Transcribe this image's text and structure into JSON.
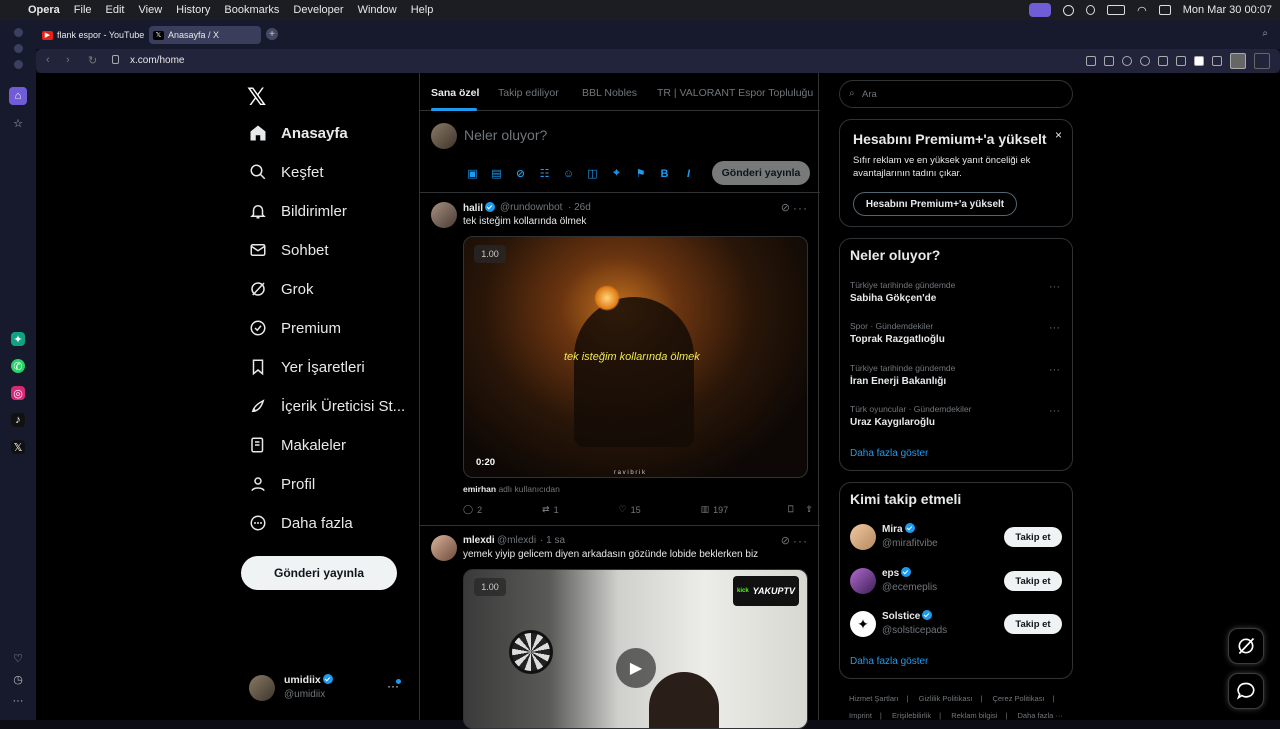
{
  "mac_menu": {
    "apple": "",
    "app": "Opera",
    "items": [
      "File",
      "Edit",
      "View",
      "History",
      "Bookmarks",
      "Developer",
      "Window",
      "Help"
    ],
    "clock": "Mon Mar 30  00:07"
  },
  "browser": {
    "tabs": [
      {
        "title": "flank espor - YouTube",
        "favicon": "youtube-icon"
      },
      {
        "title": "Anasayfa / X",
        "favicon": "x-icon"
      }
    ],
    "url": "x.com/home"
  },
  "left_nav": {
    "items": [
      {
        "label": "Anasayfa",
        "icon": "home-icon"
      },
      {
        "label": "Keşfet",
        "icon": "search-icon"
      },
      {
        "label": "Bildirimler",
        "icon": "bell-icon"
      },
      {
        "label": "Sohbet",
        "icon": "mail-icon"
      },
      {
        "label": "Grok",
        "icon": "grok-icon"
      },
      {
        "label": "Premium",
        "icon": "premium-icon"
      },
      {
        "label": "Yer İşaretleri",
        "icon": "bookmark-icon"
      },
      {
        "label": "İçerik Üreticisi St...",
        "icon": "rocket-icon"
      },
      {
        "label": "Makaleler",
        "icon": "article-icon"
      },
      {
        "label": "Profil",
        "icon": "person-icon"
      },
      {
        "label": "Daha fazla",
        "icon": "more-circle-icon"
      }
    ],
    "post_button": "Gönderi yayınla",
    "account": {
      "name": "umidiix",
      "handle": "@umidiix"
    }
  },
  "feed": {
    "tabs": [
      "Sana özel",
      "Takip ediliyor",
      "BBL Nobles",
      "TR | VALORANT Espor Topluluğu"
    ],
    "composer": {
      "placeholder": "Neler oluyor?",
      "post_button": "Gönderi yayınla"
    },
    "tweets": [
      {
        "name": "halil",
        "handle": "@rundownbot",
        "time": "· 26d",
        "text": "tek isteğim kollarında ölmek",
        "media_caption": "tek isteğim kollarında ölmek",
        "media_speed": "1.00",
        "media_duration": "0:20",
        "watermark": "r a v i b r i k",
        "tagged_user": "emirhan",
        "tagged_suffix": "adlı kullanıcıdan",
        "replies": "2",
        "reposts": "1",
        "likes": "15",
        "views": "197"
      },
      {
        "name": "mlexdi",
        "handle": "@mlexdi",
        "time": "· 1 sa",
        "text": "yemek yiyip gelicem diyen arkadasın gözünde lobide beklerken biz",
        "media_speed": "1.00",
        "overlay_logo": "YAKUPTV",
        "overlay_kick": "kick"
      }
    ]
  },
  "right_col": {
    "search_placeholder": "Ara",
    "premium": {
      "title": "Hesabını Premium+'a yükselt",
      "body": "Sıfır reklam ve en yüksek yanıt önceliği ek avantajlarının tadını çıkar.",
      "button": "Hesabını Premium+'a yükselt"
    },
    "trends": {
      "title": "Neler oluyor?",
      "items": [
        {
          "meta": "Türkiye tarihinde gündemde",
          "name": "Sabiha Gökçen'de"
        },
        {
          "meta": "Spor · Gündemdekiler",
          "name": "Toprak Razgatlıoğlu"
        },
        {
          "meta": "Türkiye tarihinde gündemde",
          "name": "İran Enerji Bakanlığı"
        },
        {
          "meta": "Türk oyuncular · Gündemdekiler",
          "name": "Uraz Kaygılaroğlu"
        }
      ],
      "show_more": "Daha fazla göster"
    },
    "who_to_follow": {
      "title": "Kimi takip etmeli",
      "items": [
        {
          "name": "Mira",
          "handle": "@mirafitvibe",
          "button": "Takip et"
        },
        {
          "name": "eps",
          "handle": "@ecemeplis",
          "button": "Takip et"
        },
        {
          "name": "Solstice",
          "handle": "@solsticepads",
          "button": "Takip et"
        }
      ],
      "show_more": "Daha fazla göster"
    },
    "footer": [
      "Hizmet Şartları",
      "|",
      "Gizlilik Politikası",
      "|",
      "Çerez Politikası",
      "|",
      "Imprint",
      "|",
      "Erişilebilirlik",
      "|",
      "Reklam bilgisi",
      "|",
      "Daha fazla ···"
    ]
  },
  "colors": {
    "accent": "#1d9bf0",
    "bg": "#000000",
    "border": "#2f3336",
    "muted": "#71767b"
  }
}
